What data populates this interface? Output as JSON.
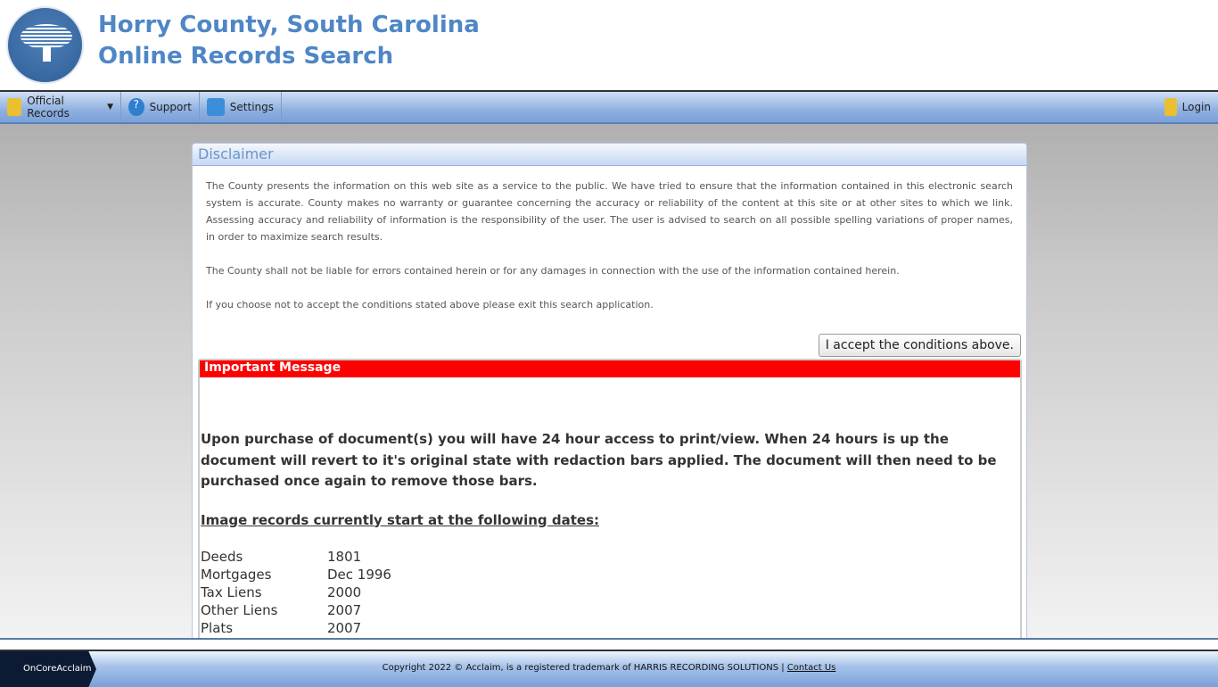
{
  "header": {
    "title_line1": "Horry County, South Carolina",
    "title_line2": "Online Records Search"
  },
  "nav": {
    "official_records": "Official Records",
    "support": "Support",
    "settings": "Settings",
    "login": "Login"
  },
  "disclaimer": {
    "title": "Disclaimer",
    "p1": "The County presents the information on this web site as a service to the public. We have tried to ensure that the information contained in this electronic search system is accurate. County makes no warranty or guarantee concerning the accuracy or reliability of the content at this site or at other sites to which we link. Assessing accuracy and reliability of information is the responsibility of the user. The user is advised to search on all possible spelling variations of proper names, in order to maximize search results.",
    "p2": "The County shall not be liable for errors contained herein or for any damages in connection with the use of the information contained herein.",
    "p3": "If you choose not to accept the conditions stated above please exit this search application.",
    "accept_label": "I accept the conditions above."
  },
  "message": {
    "title": "Important Message",
    "body": "Upon purchase of document(s) you will have 24 hour access to print/view.  When 24 hours is up the document will revert to it's original state with redaction bars applied.  The document will then need to be purchased once again to remove those bars.",
    "dates_heading": "Image records currently start at the following dates:",
    "dates": [
      {
        "type": "Deeds",
        "date": "1801"
      },
      {
        "type": "Mortgages",
        "date": "Dec 1996"
      },
      {
        "type": "Tax Liens",
        "date": "2000"
      },
      {
        "type": "Other Liens",
        "date": "2007"
      },
      {
        "type": "Plats",
        "date": "2007"
      }
    ]
  },
  "footer": {
    "logo_text": "OnCoreAcclaim",
    "copyright": "Copyright 2022 © Acclaim, is a registered trademark of HARRIS RECORDING SOLUTIONS | ",
    "contact": "Contact Us"
  }
}
